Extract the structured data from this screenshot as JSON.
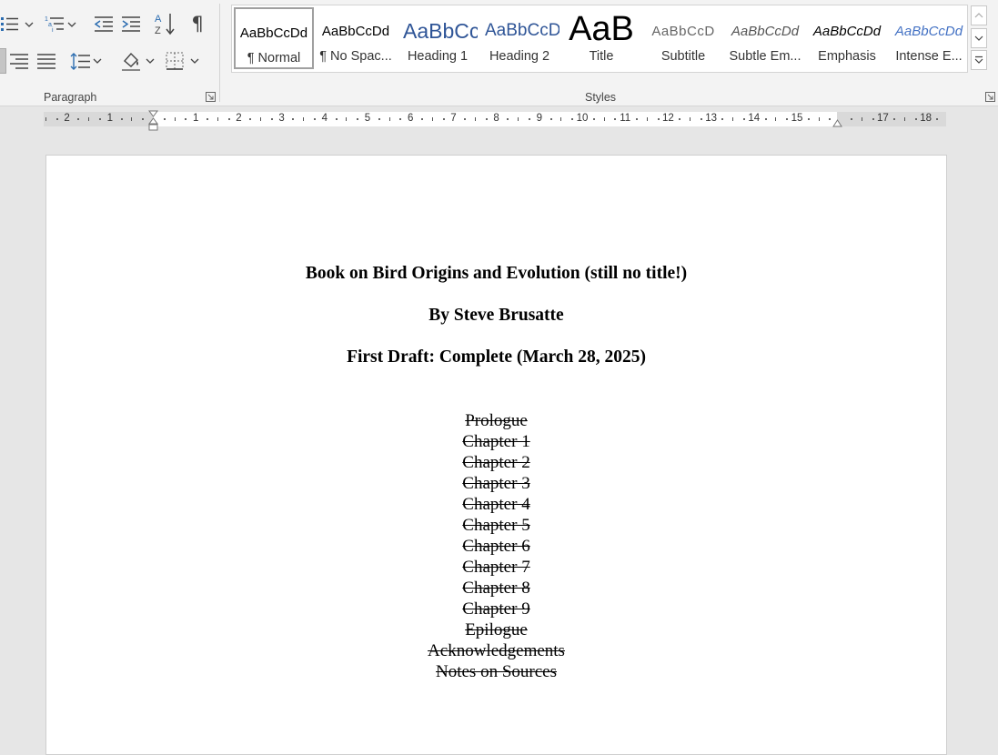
{
  "ribbon": {
    "paragraph_group_label": "Paragraph",
    "styles_group_label": "Styles",
    "paragraph_icons": [
      "bullets-icon",
      "multilevel-list-icon",
      "decrease-indent-icon",
      "increase-indent-icon",
      "sort-icon",
      "pilcrow-icon",
      "align-right-icon",
      "justify-icon",
      "line-spacing-icon",
      "shading-icon",
      "borders-icon"
    ]
  },
  "styles": [
    {
      "sample": "AaBbCcDd",
      "name": "¶ Normal",
      "selected": true
    },
    {
      "sample": "AaBbCcDd",
      "name": "¶ No Spac..."
    },
    {
      "sample": "AaBbCc",
      "name": "Heading 1"
    },
    {
      "sample": "AaBbCcD",
      "name": "Heading 2"
    },
    {
      "sample": "AaB",
      "name": "Title"
    },
    {
      "sample": "AaBbCcD",
      "name": "Subtitle"
    },
    {
      "sample": "AaBbCcDd",
      "name": "Subtle Em..."
    },
    {
      "sample": "AaBbCcDd",
      "name": "Emphasis"
    },
    {
      "sample": "AaBbCcDd",
      "name": "Intense E..."
    }
  ],
  "ruler": {
    "labels": [
      "2",
      "1",
      "1",
      "2",
      "3",
      "4",
      "5",
      "6",
      "7",
      "8",
      "9",
      "10",
      "11",
      "12",
      "13",
      "14",
      "15",
      "17",
      "18"
    ]
  },
  "document": {
    "title": "Book on Bird Origins and Evolution (still no title!)",
    "author": "By Steve Brusatte",
    "draft": "First Draft: Complete (March 28, 2025)",
    "contents": [
      "Prologue",
      "Chapter 1",
      "Chapter 2",
      "Chapter 3",
      "Chapter 4",
      "Chapter 5",
      "Chapter 6",
      "Chapter 7",
      "Chapter 8",
      "Chapter 9",
      "Epilogue",
      "Acknowledgements",
      "Notes on Sources"
    ]
  },
  "colors": {
    "ribbon_bg": "#f3f3f3",
    "workspace_bg": "#e6e6e6",
    "heading_blue": "#2f5597",
    "accent_blue": "#4472c4"
  }
}
